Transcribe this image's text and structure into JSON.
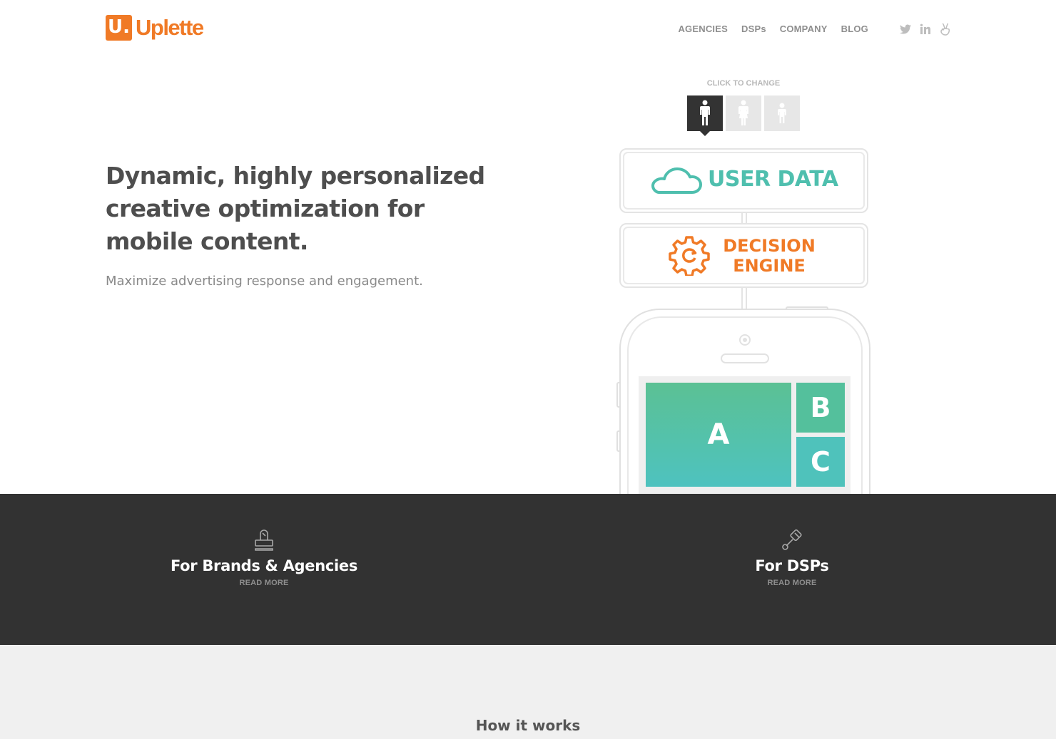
{
  "brand": {
    "mark": "U.",
    "name": "Uplette",
    "color": "#f07a26"
  },
  "nav": {
    "items": [
      "AGENCIES",
      "DSPs",
      "COMPANY",
      "BLOG"
    ],
    "social": [
      "twitter-icon",
      "linkedin-icon",
      "angellist-icon"
    ]
  },
  "hero": {
    "title": "Dynamic, highly personalized creative optimization for mobile content.",
    "subtitle": "Maximize advertising response and engagement."
  },
  "selector": {
    "label": "CLICK TO CHANGE",
    "personas": [
      "male-person-icon",
      "female-person-icon",
      "child-person-icon"
    ],
    "active_index": 0
  },
  "diagram": {
    "user_data": "USER DATA",
    "decision_engine": "DECISION ENGINE",
    "tiles": [
      "A",
      "B",
      "C"
    ],
    "colors": {
      "teal": "#4fbfae",
      "orange": "#f07a26",
      "green": "#5bc194"
    }
  },
  "features": [
    {
      "title": "For Brands & Agencies",
      "link": "READ MORE",
      "icon": "stamp-icon"
    },
    {
      "title": "For DSPs",
      "link": "READ MORE",
      "icon": "piston-icon"
    }
  ],
  "how_it_works": {
    "title": "How it works"
  }
}
